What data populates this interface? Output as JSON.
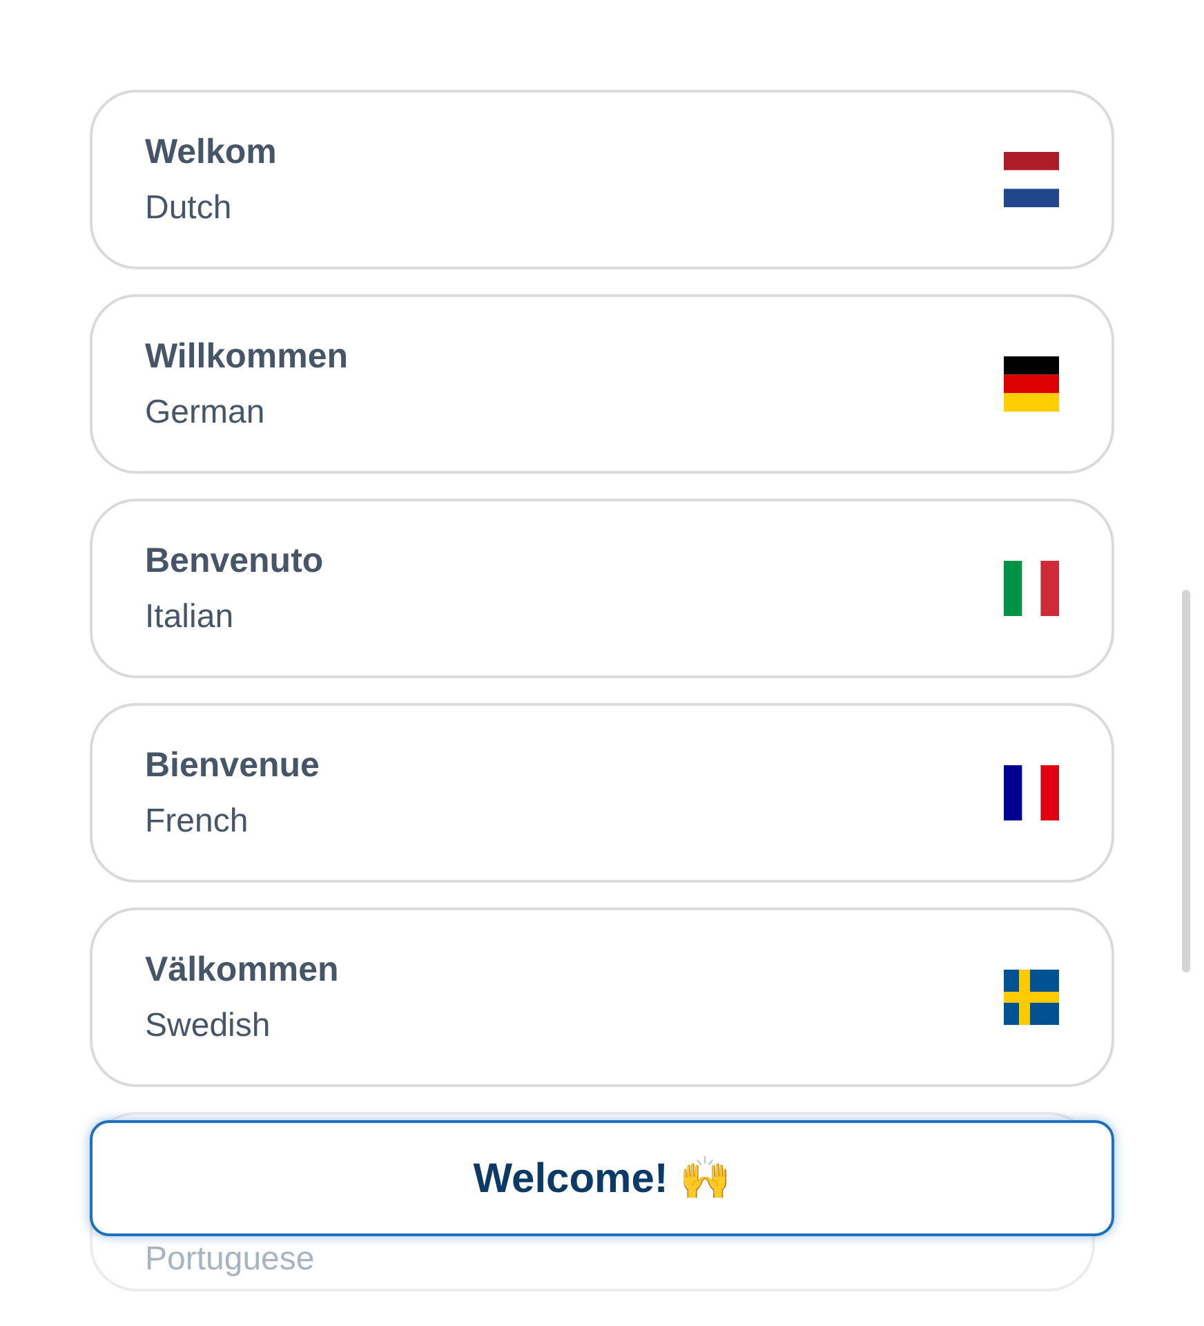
{
  "greetings": [
    {
      "greeting": "Welkom",
      "language": "Dutch",
      "kind": "nl"
    },
    {
      "greeting": "Willkommen",
      "language": "German",
      "kind": "de"
    },
    {
      "greeting": "Benvenuto",
      "language": "Italian",
      "kind": "it"
    },
    {
      "greeting": "Bienvenue",
      "language": "French",
      "kind": "fr"
    },
    {
      "greeting": "Välkommen",
      "language": "Swedish",
      "kind": "se"
    },
    {
      "language": "Portuguese",
      "kind": "faded"
    }
  ],
  "welcome_button": {
    "label": "Welcome! 🙌"
  }
}
